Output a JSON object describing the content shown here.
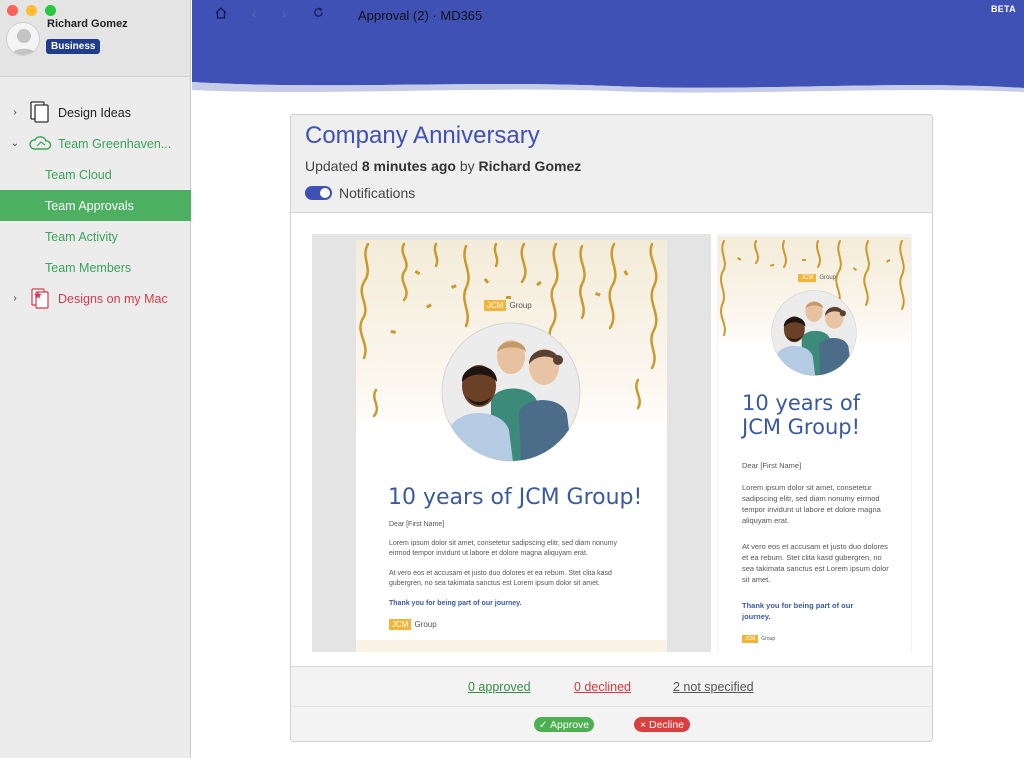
{
  "app": {
    "window_title": "Approval (2) · MD365",
    "beta_label": "BETA"
  },
  "user": {
    "name": "Richard Gomez",
    "plan": "Business"
  },
  "sidebar": {
    "items": [
      {
        "label": "Design Ideas",
        "icon": "document-stack-icon",
        "chevron": "right"
      },
      {
        "label": "Team Greenhaven...",
        "icon": "cloud-icon",
        "chevron": "down"
      },
      {
        "label": "Team Cloud"
      },
      {
        "label": "Team Approvals",
        "active": true
      },
      {
        "label": "Team Activity"
      },
      {
        "label": "Team Members"
      },
      {
        "label": "Designs on my Mac",
        "icon": "starred-documents-icon",
        "chevron": "right"
      }
    ]
  },
  "card": {
    "title": "Company Anniversary",
    "updated_prefix": "Updated",
    "updated_time": "8 minutes ago",
    "updated_by_word": "by",
    "updated_by": "Richard Gomez",
    "notifications_label": "Notifications",
    "notifications_on": true
  },
  "email": {
    "logo_badge": "JCM",
    "logo_text": "Group",
    "headline_desktop": "10 years of JCM Group!",
    "headline_mobile_line1": "10 years of",
    "headline_mobile_line2": "JCM Group!",
    "greeting": "Dear [First Name]",
    "para1": "Lorem ipsum dolor sit amet, consetetur sadipscing elitr, sed diam nonumy eirmod tempor invidunt ut labore et dolore magna aliquyam erat.",
    "para2": "At vero eos et accusam et justo duo dolores et ea rebum. Stet clita kasd gubergren, no sea takimata sanctus est Lorem ipsum dolor sit amet.",
    "thanks": "Thank you for being part of our journey."
  },
  "stats": {
    "approved": "0 approved",
    "declined": "0 declined",
    "not_specified": "2 not specified"
  },
  "actions": {
    "approve": "✓ Approve",
    "decline": "× Decline"
  },
  "colors": {
    "topbar": "#3f51b5",
    "accent_green": "#4caf62",
    "title_blue": "#3f51b5",
    "plan_badge": "#203d8c",
    "decline_red": "#d84040"
  }
}
